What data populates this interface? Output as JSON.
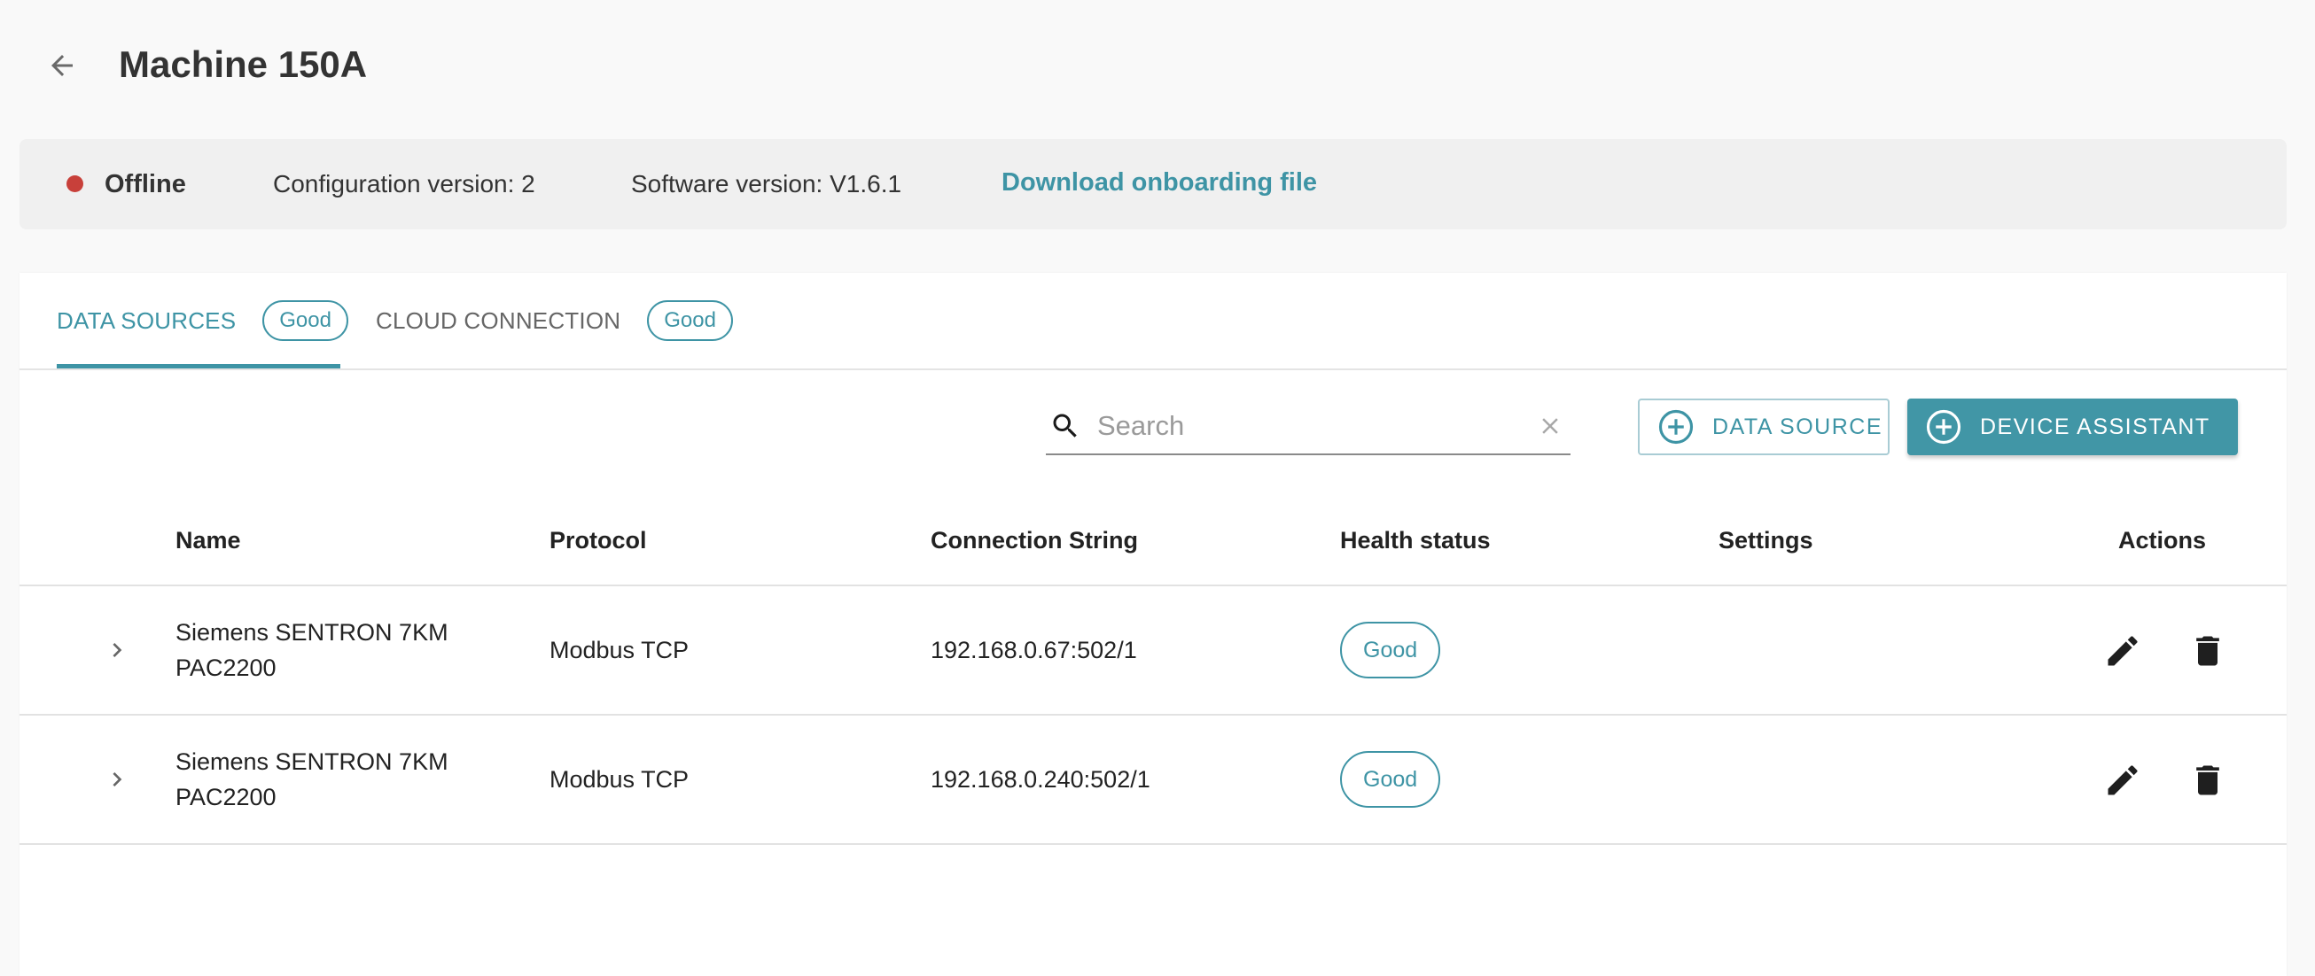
{
  "header": {
    "back_icon": "arrow-left-icon",
    "title": "Machine 150A"
  },
  "info_bar": {
    "status": "Offline",
    "status_color": "#c8403a",
    "config_version": "Configuration version: 2",
    "software_version": "Software version: V1.6.1",
    "download_link": "Download onboarding file"
  },
  "tabs": [
    {
      "label": "DATA SOURCES",
      "badge": "Good",
      "active": true
    },
    {
      "label": "CLOUD CONNECTION",
      "badge": "Good",
      "active": false
    }
  ],
  "toolbar": {
    "search_placeholder": "Search",
    "search_value": "",
    "add_data_source_label": "DATA SOURCE",
    "device_assistant_label": "DEVICE ASSISTANT"
  },
  "table": {
    "columns": [
      "Name",
      "Protocol",
      "Connection String",
      "Health status",
      "Settings",
      "Actions"
    ],
    "rows": [
      {
        "name": "Siemens SENTRON 7KM PAC2200",
        "protocol": "Modbus TCP",
        "connection": "192.168.0.67:502/1",
        "health": "Good",
        "settings": ""
      },
      {
        "name": "Siemens SENTRON 7KM PAC2200",
        "protocol": "Modbus TCP",
        "connection": "192.168.0.240:502/1",
        "health": "Good",
        "settings": ""
      }
    ]
  },
  "colors": {
    "accent": "#3e94a5",
    "accent_button": "#4196a6",
    "offline": "#c8403a"
  }
}
